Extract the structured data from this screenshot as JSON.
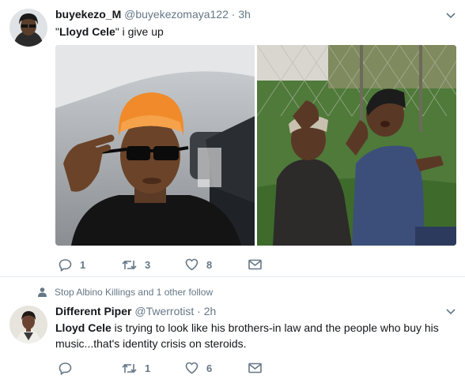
{
  "tweet1": {
    "display_name": "buyekezo_M",
    "handle": "@buyekezomaya122",
    "separator": "·",
    "time": "3h",
    "text_quote_open": "\"",
    "text_bold": "Lloyd Cele",
    "text_rest": "\" i give up",
    "actions": {
      "reply_count": "1",
      "retweet_count": "3",
      "like_count": "8"
    }
  },
  "tweet2": {
    "context": "Stop Albino Killings and 1 other follow",
    "display_name": "Different Piper",
    "handle": "@Twerrotist",
    "separator": "·",
    "time": "2h",
    "text_bold": "Lloyd Cele",
    "text_rest": " is trying to look like his brothers-in law and the people who buy his music...that's identity crisis on steroids.",
    "actions": {
      "reply_count": "",
      "retweet_count": "1",
      "like_count": "6"
    }
  },
  "colors": {
    "icon_gray": "#657786",
    "text": "#14171a",
    "divider": "#e6ecf0"
  }
}
